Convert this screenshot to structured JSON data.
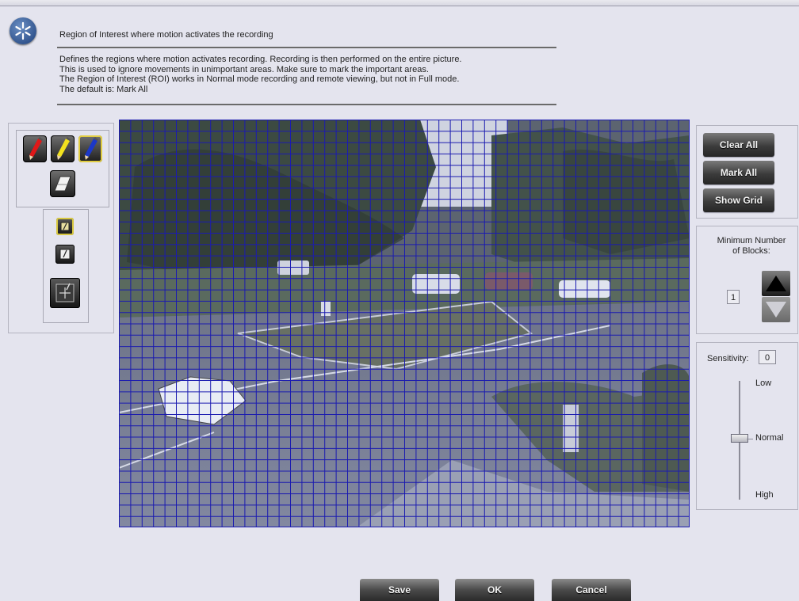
{
  "header": {
    "title": "Region of Interest where motion activates the recording",
    "description": [
      "Defines the regions where motion activates recording.  Recording is then performed on the entire picture.",
      "This is used to ignore movements in unimportant areas.  Make sure to mark the important areas.",
      "The Region of Interest (ROI) works in Normal mode recording and remote viewing, but not in Full mode.",
      "The default is: Mark All"
    ]
  },
  "tools": {
    "pens": [
      {
        "icon": "red-pencil-icon",
        "color": "#e01818",
        "selected": false
      },
      {
        "icon": "yellow-pencil-icon",
        "color": "#f2e21e",
        "selected": false
      },
      {
        "icon": "blue-pencil-icon",
        "color": "#1c38c8",
        "selected": true
      }
    ],
    "eraser_icon": "eraser-icon",
    "pen_size_icons": [
      "small-pen-icon",
      "medium-pen-icon",
      "large-pen-icon"
    ]
  },
  "grid": {
    "color": "#1b1bb0",
    "visible": true,
    "cols": 50,
    "rows": 36
  },
  "actions": {
    "clear_all": "Clear All",
    "mark_all": "Mark All",
    "show_grid": "Show Grid"
  },
  "min_blocks": {
    "label_line1": "Minimum Number",
    "label_line2": "of Blocks:",
    "value": "1"
  },
  "sensitivity": {
    "label": "Sensitivity:",
    "value": "0",
    "levels": [
      "Low",
      "Normal",
      "High"
    ],
    "current_level": "Normal"
  },
  "footer": {
    "save": "Save",
    "ok": "OK",
    "cancel": "Cancel"
  }
}
